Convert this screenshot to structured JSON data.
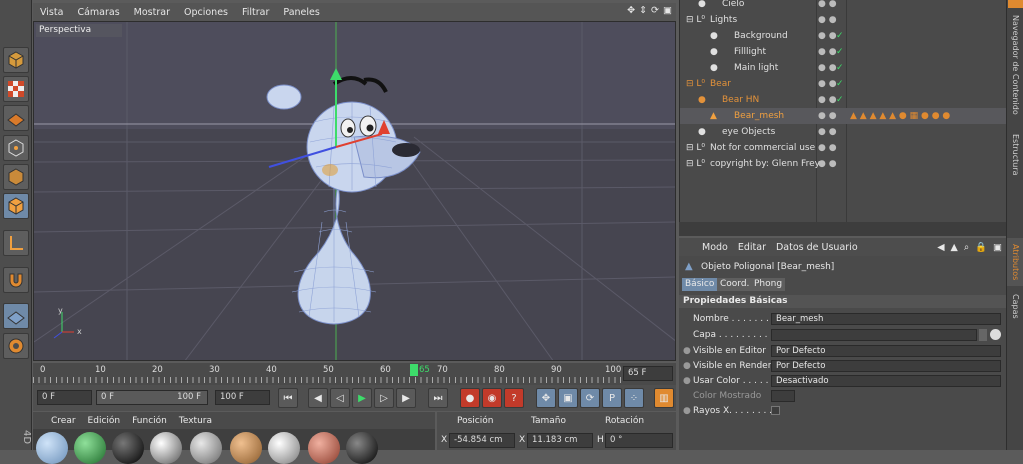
{
  "viewport": {
    "menu": [
      "Vista",
      "Cámaras",
      "Mostrar",
      "Opciones",
      "Filtrar",
      "Paneles"
    ],
    "label": "Perspectiva",
    "axis_x": "x",
    "axis_y": "y"
  },
  "timeline": {
    "ticks": [
      "0",
      "10",
      "20",
      "30",
      "40",
      "50",
      "60",
      "65",
      "70",
      "80",
      "90",
      "100"
    ],
    "current_frame": "65",
    "end_frame": "65 F"
  },
  "transport": {
    "start_field": "0 F",
    "range_start": "0 F",
    "range_end": "100 F",
    "max_field": "100 F"
  },
  "materials": {
    "menu": [
      "Crear",
      "Edición",
      "Función",
      "Textura"
    ]
  },
  "coords": {
    "headers": [
      "Posición",
      "Tamaño",
      "Rotación"
    ],
    "pos_label": "X",
    "pos_value": "-54.854 cm",
    "size_label": "X",
    "size_value": "11.183 cm",
    "rot_label": "H",
    "rot_value": "0 °"
  },
  "objects": [
    {
      "name": "Cielo",
      "indent": 1,
      "color": "#e0e0e0"
    },
    {
      "name": "Lights",
      "indent": 0,
      "color": "#e0e0e0"
    },
    {
      "name": "Background",
      "indent": 2,
      "color": "#e0e0e0"
    },
    {
      "name": "Filllight",
      "indent": 2,
      "color": "#e0e0e0"
    },
    {
      "name": "Main light",
      "indent": 2,
      "color": "#e0e0e0"
    },
    {
      "name": "Bear",
      "indent": 0,
      "color": "#e3923a"
    },
    {
      "name": "Bear HN",
      "indent": 1,
      "color": "#e3923a"
    },
    {
      "name": "Bear_mesh",
      "indent": 2,
      "color": "#f0a040"
    },
    {
      "name": "eye Objects",
      "indent": 1,
      "color": "#e0e0e0"
    },
    {
      "name": "Not for commercial use",
      "indent": 0,
      "color": "#e0e0e0"
    },
    {
      "name": "copyright by: Glenn Frey",
      "indent": 0,
      "color": "#e0e0e0"
    }
  ],
  "attributes": {
    "menu": [
      "Modo",
      "Editar",
      "Datos de Usuario"
    ],
    "object_title": "Objeto Poligonal [Bear_mesh]",
    "tabs": [
      "Básico",
      "Coord.",
      "Phong"
    ],
    "section": "Propiedades Básicas",
    "fields": [
      {
        "label": "Nombre . . . . . . . .",
        "value": "Bear_mesh"
      },
      {
        "label": "Capa . . . . . . . . . .",
        "value": ""
      },
      {
        "label": "Visible en Editor",
        "value": "Por Defecto"
      },
      {
        "label": "Visible en Render",
        "value": "Por Defecto"
      },
      {
        "label": "Usar Color . . . . . .",
        "value": "Desactivado"
      },
      {
        "label": "Color Mostrado",
        "value": ""
      },
      {
        "label": "Rayos X. . . . . . . .",
        "value": ""
      }
    ]
  },
  "right_tabs": [
    "Navegador de Contenido",
    "Estructura",
    "Atributos",
    "Capas"
  ],
  "colors": {
    "accent_blue": "#6f8aa8",
    "green_marker": "#3ddc6a",
    "orange_selected": "#f0a040"
  }
}
